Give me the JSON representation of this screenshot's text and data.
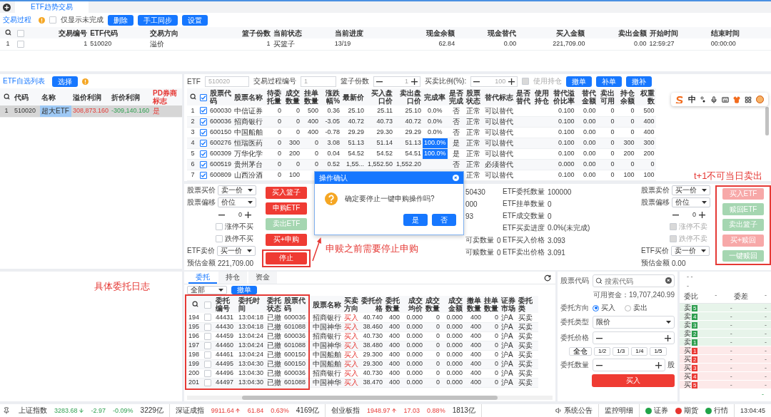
{
  "app_tabs": [
    {
      "label": "ETF趋势交易",
      "selected": true
    }
  ],
  "process": {
    "tab": "交易过程",
    "only_unfinished": {
      "label": "仅显示未完成",
      "checked": false
    },
    "buttons": [
      "删除",
      "手工同步",
      "设置"
    ],
    "header_checked": false,
    "columns": [
      "交易编号",
      "ETF代码",
      "交易方向",
      "篮子份数",
      "当前状态",
      "当前进度",
      "现金余额",
      "现金替代",
      "买入金额",
      "卖出金额",
      "开始时间",
      "结束时间"
    ],
    "rows": [
      {
        "index": "1",
        "checked": false,
        "cells": [
          "1",
          "510020",
          "溢价",
          "1",
          "买篮子",
          "13/19",
          "62.84",
          "0.00",
          "221,709.00",
          "0.00",
          "12:59:27",
          "00:00:00"
        ]
      }
    ]
  },
  "etf_list": {
    "title": "ETF自选列表",
    "button": "选择",
    "columns": [
      "代码",
      "名称",
      "溢价利润",
      "折价利润",
      "PD券商标志"
    ],
    "rows": [
      {
        "index": "1",
        "selected": true,
        "code": "510020",
        "name": "超大ETF",
        "premium": "308,873.160",
        "discount": "-309,140.160",
        "pd": "是"
      }
    ]
  },
  "basket": {
    "fields": [
      {
        "label": "ETF",
        "value": "510020",
        "disabled": true
      },
      {
        "label": "交易过程编号",
        "value": "1",
        "disabled": true
      }
    ],
    "steppers": [
      {
        "label": "篮子份数",
        "value": "1"
      },
      {
        "label": "买卖比例(%):",
        "value": "100"
      }
    ],
    "use_position": {
      "label": "使用持仓",
      "checked": false,
      "disabled": true
    },
    "buttons": [
      "撤单",
      "补单",
      "撤补"
    ],
    "header_checked": true,
    "columns": [
      "股票代码",
      "股票名称",
      "待委托量",
      "成交数量",
      "挂单数量",
      "涨跌幅%",
      "最新价",
      "买入盘口价",
      "卖出盘口价",
      "完成率",
      "是否完成",
      "股票状态",
      "替代标志",
      "是否替代",
      "使用持仓",
      "替代溢价比率",
      "替代金额",
      "卖出可用",
      "持仓余额",
      "权重数"
    ],
    "rows": [
      {
        "index": "1",
        "checked": true,
        "rate_highlighted": false,
        "cells": [
          "600030",
          "中信证券",
          "0",
          "0",
          "500",
          "0.36",
          "25.10",
          "25.11",
          "25.10",
          "0.0%",
          "否",
          "正常",
          "可以替代",
          null,
          null,
          "0.100",
          "0.00",
          "0",
          "0",
          "500"
        ]
      },
      {
        "index": "2",
        "checked": true,
        "rate_highlighted": false,
        "cells": [
          "600036",
          "招商银行",
          "0",
          "0",
          "400",
          "-3.05",
          "40.72",
          "40.73",
          "40.72",
          "0.0%",
          "否",
          "正常",
          "可以替代",
          null,
          null,
          "0.100",
          "0.00",
          "0",
          "0",
          "400"
        ]
      },
      {
        "index": "3",
        "checked": true,
        "rate_highlighted": false,
        "cells": [
          "600150",
          "中国船舶",
          "0",
          "0",
          "400",
          "-0.78",
          "29.29",
          "29.30",
          "29.29",
          "0.0%",
          "否",
          "正常",
          "可以替代",
          null,
          null,
          "0.100",
          "0.00",
          "0",
          "0",
          "400"
        ]
      },
      {
        "index": "4",
        "checked": true,
        "rate_highlighted": true,
        "cells": [
          "600276",
          "恒瑞医药",
          "0",
          "300",
          "0",
          "3.08",
          "51.13",
          "51.14",
          "51.13",
          "100.0%",
          "是",
          "正常",
          "可以替代",
          null,
          null,
          "0.100",
          "0.00",
          "0",
          "300",
          "300"
        ]
      },
      {
        "index": "5",
        "checked": true,
        "rate_highlighted": true,
        "cells": [
          "600309",
          "万华化学",
          "0",
          "200",
          "0",
          "0.04",
          "54.52",
          "54.52",
          "54.51",
          "100.0%",
          "是",
          "正常",
          "可以替代",
          null,
          null,
          "0.100",
          "0.00",
          "0",
          "200",
          "200"
        ]
      },
      {
        "index": "6",
        "checked": true,
        "cells": [
          "600519",
          "贵州茅台",
          "0",
          "0",
          "0",
          "0.52",
          "1,55...",
          "1,552.50",
          "1,552.20",
          null,
          "否",
          "正常",
          "必须替代",
          null,
          null,
          "0.000",
          "0.00",
          "0",
          "0",
          "0"
        ]
      },
      {
        "index": "7",
        "checked": true,
        "cells": [
          "600809",
          "山西汾酒",
          "0",
          "100",
          null,
          null,
          null,
          null,
          null,
          null,
          null,
          "正常",
          "可以替代",
          null,
          null,
          "0.100",
          "0.00",
          "0",
          "100",
          "100"
        ]
      }
    ]
  },
  "ime_bar": {
    "mode": "中"
  },
  "trade_panel": {
    "buy_side": {
      "price_label": "股票买价",
      "price_select": "卖一价",
      "offset_label": "股票偏移",
      "offset_select": "价位",
      "offset_value": "0",
      "limit_checks": [
        {
          "label": "涨停不买",
          "checked": false,
          "disabled": false
        },
        {
          "label": "跌停不买",
          "checked": false,
          "disabled": false
        }
      ],
      "etf_label": "ETF卖价",
      "etf_select": "买一价",
      "estimate_label": "预估金额",
      "estimate": "221,709.00"
    },
    "buy_buttons": [
      {
        "label": "买入篮子",
        "kind": "buy",
        "disabled": false
      },
      {
        "label": "申购ETF",
        "kind": "buy",
        "disabled": false
      },
      {
        "label": "卖出ETF",
        "kind": "sell",
        "disabled": true
      },
      {
        "label": "买+申购",
        "kind": "buy",
        "disabled": false
      },
      {
        "label": "停止",
        "kind": "buy",
        "disabled": false
      }
    ],
    "info_left": [
      {
        "kind": "fragment",
        "text": "50430"
      },
      {
        "kind": "fragment",
        "text": "000"
      },
      {
        "kind": "fragment",
        "text": "93"
      },
      {
        "kind": "hidden"
      },
      {
        "kind": "field",
        "label": "可卖数量",
        "value": "0"
      },
      {
        "kind": "field",
        "label": "可赎数量",
        "value": "0"
      }
    ],
    "info_right": [
      {
        "label": "ETF委托数量",
        "value": "100000"
      },
      {
        "label": "ETF挂单数量",
        "value": "0"
      },
      {
        "label": "ETF成交数量",
        "value": "0"
      },
      {
        "label": "ETF买卖进度",
        "value": "0.0%(未完成)"
      },
      {
        "label": "ETF买入价格",
        "value": "3.093"
      },
      {
        "label": "ETF卖出价格",
        "value": "3.091"
      }
    ],
    "sell_side": {
      "price_label": "股票卖价",
      "price_select": "买一价",
      "offset_label": "股票偏移",
      "offset_select": "价位",
      "offset_value": "0",
      "limit_checks": [
        {
          "label": "涨停不卖",
          "checked": false,
          "disabled": true
        },
        {
          "label": "跌停不卖",
          "checked": false,
          "disabled": true
        }
      ],
      "etf_label": "ETF买价",
      "etf_select": "卖一价",
      "estimate_label": "预估金额",
      "estimate": "0.00"
    },
    "sell_buttons": [
      {
        "label": "买入ETF",
        "kind": "buy",
        "disabled": true
      },
      {
        "label": "赎回ETF",
        "kind": "sell",
        "disabled": true
      },
      {
        "label": "卖出篮子",
        "kind": "sell",
        "disabled": true
      },
      {
        "label": "买+赎回",
        "kind": "buy",
        "disabled": true
      },
      {
        "label": "一键赎回",
        "kind": "sell",
        "disabled": true
      }
    ]
  },
  "dialog": {
    "title": "操作确认",
    "message": "确定要停止一键申购操作吗?",
    "buttons": [
      "是",
      "否"
    ]
  },
  "orders": {
    "tabs": [
      {
        "label": "委托",
        "selected": true
      },
      {
        "label": "持仓",
        "selected": false
      },
      {
        "label": "资金",
        "selected": false
      }
    ],
    "filter": "全部",
    "button": "撤单",
    "header_checked": false,
    "columns": [
      "委托编号",
      "委托时间",
      "委托状态",
      "股票代码",
      "股票名称",
      "买卖方向",
      "委托价格",
      "委托数量",
      "成交均价",
      "成交数量",
      "成交金额",
      "撤单数量",
      "挂单数量",
      "证券市场",
      "委托类"
    ],
    "rows": [
      {
        "index": "194",
        "checked": false,
        "cells": [
          "44431",
          "13:04:18",
          "已撤",
          "600036",
          "招商银行",
          "买入",
          "40.740",
          "400",
          "0.000",
          "0",
          "0.000",
          "400",
          "0",
          "沪A",
          "买卖"
        ]
      },
      {
        "index": "195",
        "checked": false,
        "cells": [
          "44430",
          "13:04:18",
          "已撤",
          "601088",
          "中国神华",
          "买入",
          "38.460",
          "400",
          "0.000",
          "0",
          "0.000",
          "400",
          "0",
          "沪A",
          "买卖"
        ]
      },
      {
        "index": "196",
        "checked": false,
        "cells": [
          "44459",
          "13:04:24",
          "已撤",
          "600036",
          "招商银行",
          "买入",
          "40.730",
          "400",
          "0.000",
          "0",
          "0.000",
          "400",
          "0",
          "沪A",
          "买卖"
        ]
      },
      {
        "index": "197",
        "checked": false,
        "cells": [
          "44460",
          "13:04:24",
          "已撤",
          "601088",
          "中国神华",
          "买入",
          "38.480",
          "400",
          "0.000",
          "0",
          "0.000",
          "400",
          "0",
          "沪A",
          "买卖"
        ]
      },
      {
        "index": "198",
        "checked": false,
        "cells": [
          "44461",
          "13:04:24",
          "已撤",
          "600150",
          "中国船舶",
          "买入",
          "29.300",
          "400",
          "0.000",
          "0",
          "0.000",
          "400",
          "0",
          "沪A",
          "买卖"
        ]
      },
      {
        "index": "199",
        "checked": false,
        "cells": [
          "44495",
          "13:04:30",
          "已撤",
          "600150",
          "中国船舶",
          "买入",
          "29.300",
          "400",
          "0.000",
          "0",
          "0.000",
          "400",
          "0",
          "沪A",
          "买卖"
        ]
      },
      {
        "index": "200",
        "checked": false,
        "cells": [
          "44496",
          "13:04:30",
          "已撤",
          "600036",
          "招商银行",
          "买入",
          "40.730",
          "400",
          "0.000",
          "0",
          "0.000",
          "400",
          "0",
          "沪A",
          "买卖"
        ]
      },
      {
        "index": "201",
        "checked": false,
        "cells": [
          "44497",
          "13:04:30",
          "已撤",
          "601088",
          "中国神华",
          "买入",
          "38.470",
          "400",
          "0.000",
          "0",
          "0.000",
          "400",
          "0",
          "沪A",
          "买卖"
        ]
      }
    ]
  },
  "order_form": {
    "code_label": "股票代码",
    "placeholder": "搜索代码",
    "funds": "可用资金：19,707,240.99",
    "direction_label": "委托方向",
    "directions": [
      {
        "label": "买入",
        "selected": true
      },
      {
        "label": "卖出",
        "selected": false
      }
    ],
    "type_label": "委托类型",
    "type_value": "限价",
    "price_label": "委托价格",
    "fractions": [
      "全仓",
      "1/2",
      "1/3",
      "1/4",
      "1/5"
    ],
    "qty_label": "委托数量",
    "qty_unit": "股",
    "submit": "买入"
  },
  "order_book": {
    "top": [
      "- -",
      "-"
    ],
    "header": [
      {
        "label": "委比",
        "value": "-"
      },
      {
        "label": "委差",
        "value": "-"
      }
    ],
    "levels": [
      {
        "kind": "sell",
        "label": "卖",
        "level_no": "5",
        "price": "-",
        "volume": "-"
      },
      {
        "kind": "sell",
        "label": "卖",
        "level_no": "4",
        "price": "-",
        "volume": "-"
      },
      {
        "kind": "sell",
        "label": "卖",
        "level_no": "3",
        "price": "-",
        "volume": "-"
      },
      {
        "kind": "sell",
        "label": "卖",
        "level_no": "2",
        "price": "-",
        "volume": "-"
      },
      {
        "kind": "sell",
        "label": "卖",
        "level_no": "1",
        "price": "-",
        "volume": "-"
      },
      {
        "kind": "buy",
        "label": "买",
        "level_no": "1",
        "price": "-",
        "volume": "-"
      },
      {
        "kind": "buy",
        "label": "买",
        "level_no": "2",
        "price": "-",
        "volume": "-"
      },
      {
        "kind": "buy",
        "label": "买",
        "level_no": "3",
        "price": "-",
        "volume": "-"
      },
      {
        "kind": "buy",
        "label": "买",
        "level_no": "4",
        "price": "-",
        "volume": "-"
      },
      {
        "kind": "buy",
        "label": "买",
        "level_no": "5",
        "price": "-",
        "volume": "-"
      }
    ],
    "footer": "-"
  },
  "status_bar": {
    "indices": [
      {
        "name": "上证指数",
        "value": "3283.68",
        "kind": "down",
        "change": "-2.97",
        "percent": "-0.09%",
        "turnover": "3229亿"
      },
      {
        "name": "深证成指",
        "value": "9911.64",
        "kind": "up",
        "change": "61.84",
        "percent": "0.63%",
        "turnover": "4169亿"
      },
      {
        "name": "创业板指",
        "value": "1948.97",
        "kind": "up",
        "change": "17.03",
        "percent": "0.88%",
        "turnover": "1813亿"
      }
    ],
    "notice": "系统公告",
    "monitor": "监控明细",
    "connections": [
      {
        "label": "证券",
        "color": "#21a348"
      },
      {
        "label": "期货",
        "color": "#e8342f"
      },
      {
        "label": "行情",
        "color": "#21a348"
      }
    ],
    "time": "13:04:45"
  },
  "annotations": {
    "orders_note": "具体委托日志",
    "stop_note": "申赎之前需要停止申购",
    "t1_note": "t+1不可当日卖出"
  }
}
